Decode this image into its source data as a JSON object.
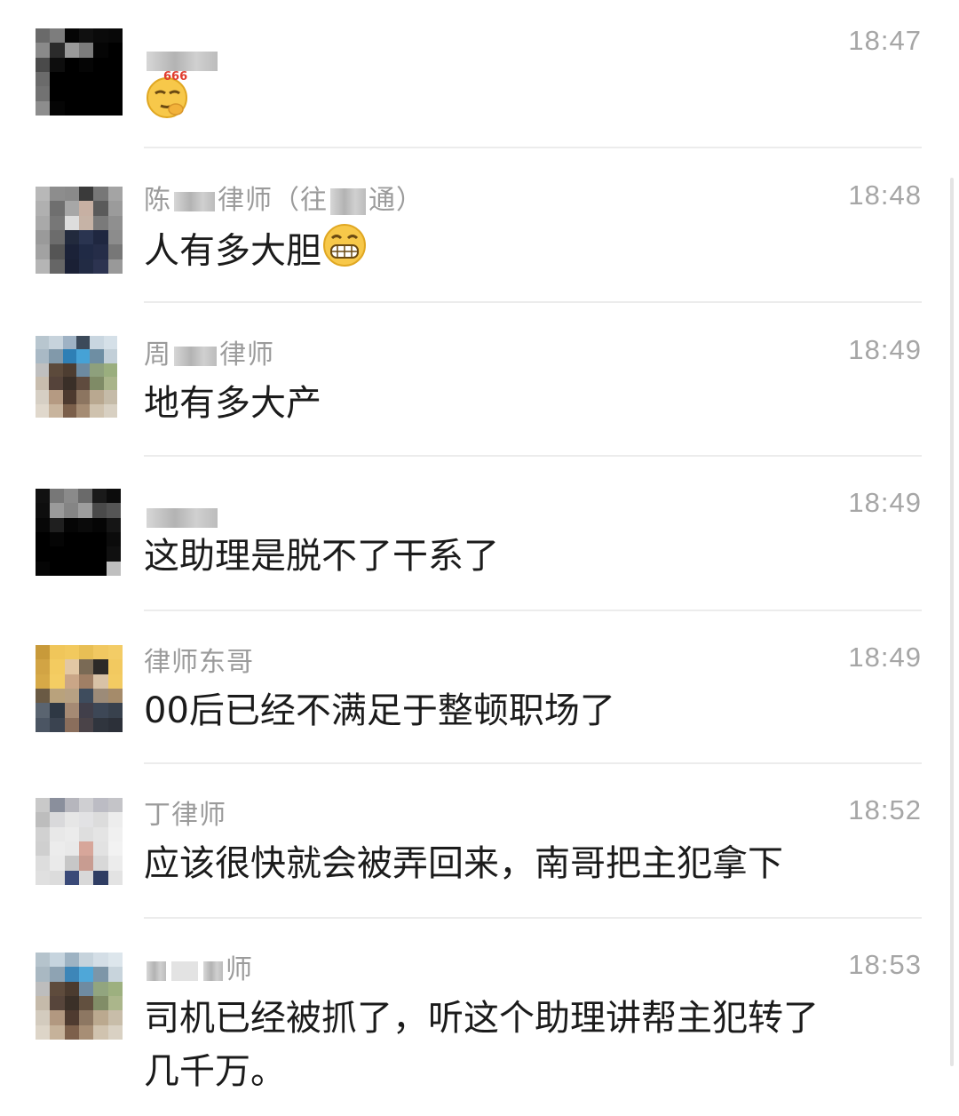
{
  "messages": [
    {
      "name": "",
      "time": "18:47",
      "text": "",
      "emoji": "thinking-666-emoji"
    },
    {
      "name_prefix": "陈",
      "name_suffix": "律师（往",
      "name_end": "通）",
      "time": "18:48",
      "text": "人有多大胆",
      "emoji": "grin-emoji"
    },
    {
      "name_prefix": "周",
      "name_suffix": "律师",
      "time": "18:49",
      "text": "地有多大产"
    },
    {
      "name": "",
      "time": "18:49",
      "text": "这助理是脱不了干系了"
    },
    {
      "name": "律师东哥",
      "time": "18:49",
      "text": "00后已经不满足于整顿职场了"
    },
    {
      "name": "丁律师",
      "time": "18:52",
      "text": "应该很快就会被弄回来，南哥把主犯拿下"
    },
    {
      "name_suffix": "师",
      "time": "18:53",
      "text_line1": "司机已经被抓了，听这个助理讲帮主犯转了",
      "text_line2": "几千万。"
    }
  ],
  "emoji_666_label": "666",
  "colors": {
    "name": "#9b9b9b",
    "time": "#a6a6a6",
    "text": "#1b1b1b",
    "divider": "#ececec"
  }
}
